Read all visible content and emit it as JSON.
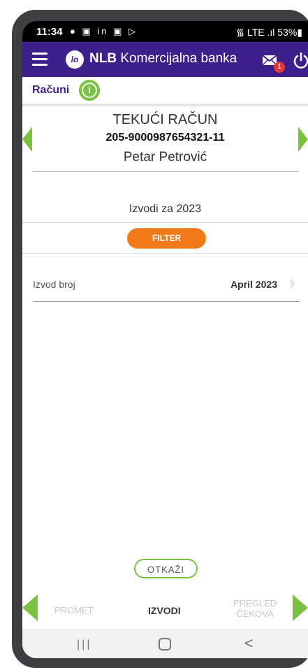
{
  "status_bar": {
    "time": "11:34",
    "notification_icons": "● ▣ in ▣ ▷",
    "right": "᯾ LTE .ıl 53%▮"
  },
  "app_bar": {
    "logo_mark": "lo",
    "brand_bold": "NLB",
    "brand_rest": " Komercijalna banka",
    "mail_badge": "1"
  },
  "section": {
    "title": "Računi",
    "info_glyph": "i"
  },
  "account": {
    "type": "TEKUĆI RAČUN",
    "number": "205-9000987654321-11",
    "holder": "Petar Petrović"
  },
  "statements": {
    "year_title": "Izvodi za 2023",
    "filter_label": "FILTER",
    "rows": [
      {
        "label": "Izvod broj",
        "value": "April 2023"
      }
    ],
    "cancel_label": "OTKAŽI"
  },
  "bottom_tabs": {
    "promet": "PROMET",
    "izvodi": "IZVODI",
    "pregled_line1": "PREGLED",
    "pregled_line2": "ČEKOVA"
  },
  "system_nav": {
    "recents": "|||",
    "back": "<"
  },
  "colors": {
    "brand_purple": "#3f1f8c",
    "accent_green": "#7cc242",
    "filter_orange": "#f07a1a"
  }
}
